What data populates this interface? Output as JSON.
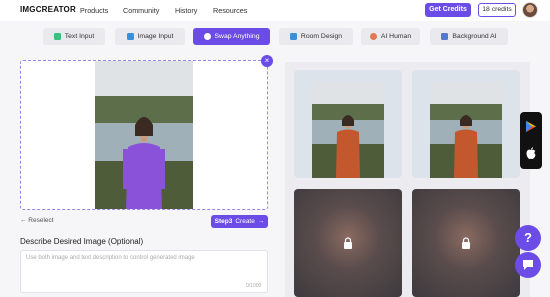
{
  "nav": {
    "logo": "IMGCREATOR",
    "links": [
      "Products",
      "Community",
      "History",
      "Resources"
    ],
    "get_credits": "Get Credits",
    "credits": "18 credits"
  },
  "tabs": [
    {
      "label": "Text Input",
      "icon": "text-icon"
    },
    {
      "label": "Image Input",
      "icon": "image-icon"
    },
    {
      "label": "Swap Anything",
      "icon": "swap-icon",
      "active": true
    },
    {
      "label": "Room Design",
      "icon": "home-icon"
    },
    {
      "label": "AI Human",
      "icon": "human-icon"
    },
    {
      "label": "Background AI",
      "icon": "background-icon"
    }
  ],
  "editor": {
    "reselect": "← Reselect",
    "step": "Step3",
    "create": "Create",
    "desc_label": "Describe Desired Image (Optional)",
    "desc_placeholder": "Use both image and text description to control generated image",
    "desc_count": "0/1000"
  },
  "colors": {
    "accent": "#6c4ce6",
    "mask": "#8a52d9"
  }
}
